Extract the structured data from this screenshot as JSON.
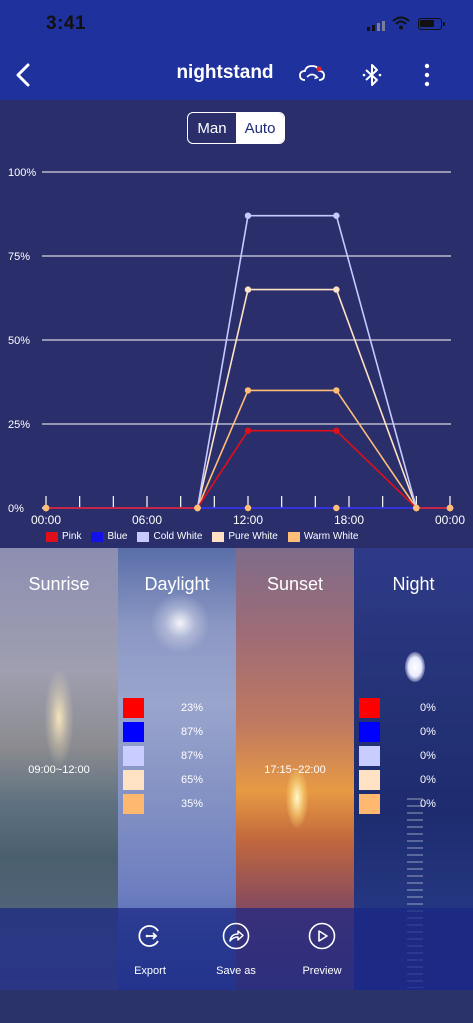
{
  "status_bar": {
    "time": "3:41"
  },
  "nav": {
    "title": "nightstand",
    "icons": [
      "back-chevron-icon",
      "cloud-sync-icon",
      "bluetooth-icon",
      "more-vertical-icon"
    ]
  },
  "mode_toggle": {
    "options": [
      "Man",
      "Auto"
    ],
    "selected": "Auto"
  },
  "chart_data": {
    "type": "line",
    "x": [
      "00:00",
      "09:00",
      "12:00",
      "17:15",
      "22:00",
      "24:00"
    ],
    "x_tick_labels": [
      "00:00",
      "06:00",
      "12:00",
      "18:00",
      "00:00"
    ],
    "y_tick_labels": [
      "0%",
      "25%",
      "50%",
      "75%",
      "100%"
    ],
    "ylim": [
      0,
      100
    ],
    "series": [
      {
        "name": "Pink",
        "color": "#e0101a",
        "values": [
          0,
          0,
          23,
          23,
          0,
          0
        ]
      },
      {
        "name": "Blue",
        "color": "#1212e8",
        "values": [
          0,
          0,
          0,
          0,
          0,
          0
        ]
      },
      {
        "name": "Cold White",
        "color": "#c7c9ff",
        "values": [
          0,
          0,
          87,
          87,
          0,
          0
        ]
      },
      {
        "name": "Pure White",
        "color": "#ffe2c4",
        "values": [
          0,
          0,
          65,
          65,
          0,
          0
        ]
      },
      {
        "name": "Warm White",
        "color": "#ffbe78",
        "values": [
          0,
          0,
          35,
          35,
          0,
          0
        ]
      }
    ],
    "grid": true,
    "legend": "bottom"
  },
  "phases": [
    {
      "name": "Sunrise",
      "range": "09:00~12:00"
    },
    {
      "name": "Daylight",
      "levels": [
        "23%",
        "87%",
        "87%",
        "65%",
        "35%"
      ]
    },
    {
      "name": "Sunset",
      "range": "17:15~22:00"
    },
    {
      "name": "Night",
      "levels": [
        "0%",
        "0%",
        "0%",
        "0%",
        "0%"
      ]
    }
  ],
  "swatch_colors": [
    "#ff0000",
    "#0000ff",
    "#c9ccff",
    "#ffe2c4",
    "#ffb870"
  ],
  "actions": [
    {
      "label": "Export",
      "icon": "export-icon"
    },
    {
      "label": "Save as",
      "icon": "share-icon"
    },
    {
      "label": "Preview",
      "icon": "play-icon"
    }
  ]
}
